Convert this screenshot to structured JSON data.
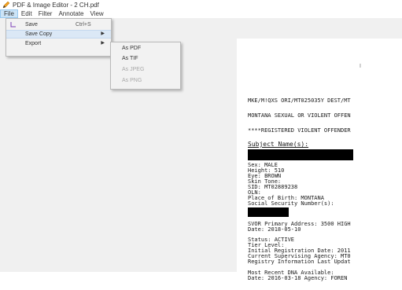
{
  "window": {
    "title": "PDF & Image Editor - 2 CH.pdf"
  },
  "menubar": {
    "items": [
      "File",
      "Edit",
      "Filter",
      "Annotate",
      "View"
    ]
  },
  "file_menu": {
    "save_label": "Save",
    "save_shortcut": "Ctrl+S",
    "save_copy_label": "Save Copy",
    "export_label": "Export"
  },
  "save_copy_submenu": {
    "items": [
      {
        "label": "As PDF",
        "enabled": true
      },
      {
        "label": "As TIF",
        "enabled": true
      },
      {
        "label": "As JPEG",
        "enabled": false
      },
      {
        "label": "As PNG",
        "enabled": false
      }
    ]
  },
  "document": {
    "page_marker": "I",
    "lines": [
      "MKE/M!QXS ORI/MT025035Y DEST/MT",
      "MONTANA SEXUAL OR VIOLENT OFFEN",
      "****REGISTERED VIOLENT OFFENDER",
      "Subject Name(s):",
      "Sex: MALE",
      "Height: 510",
      "Eye: BROWN",
      "Skin Tone:",
      "SID: MT02889238",
      "OLN:",
      "Place of Birth: MONTANA",
      "Social Security Number(s):",
      "SVOR Primary Address: 3500 HIGH",
      "Date: 2018-05-10",
      "Status: ACTIVE",
      "Tier Level:",
      "Initial Registration Date: 2011",
      "Current Supervising Agency: MT0",
      "Registry Information Last Updat",
      "Most Recent DNA Available:",
      "Date: 2016-03-18  Agency: FOREN"
    ]
  },
  "colors": {
    "menu_highlight": "#cce4f7",
    "workspace": "#f0f0f0",
    "redaction": "#000000"
  }
}
